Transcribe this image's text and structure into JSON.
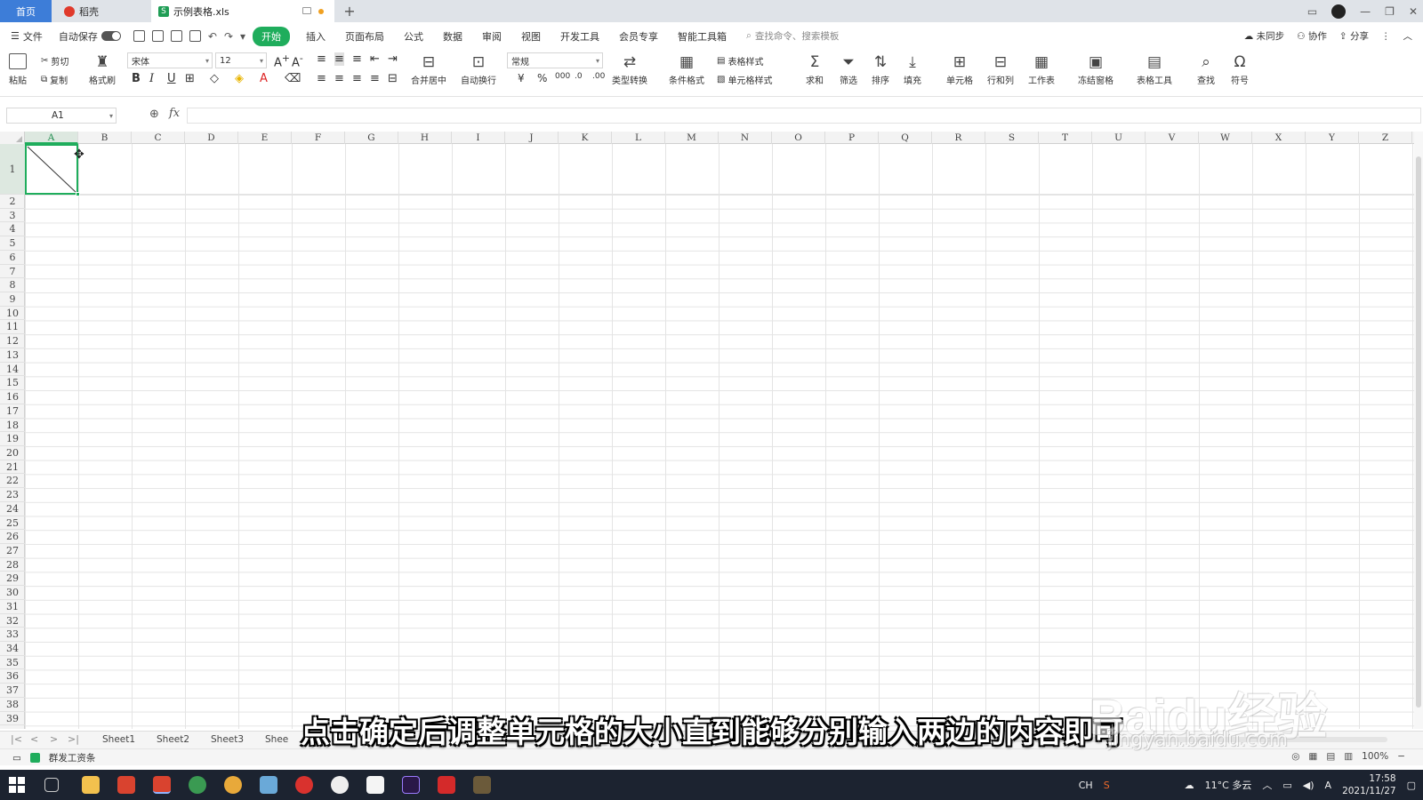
{
  "tabs": {
    "home": "首页",
    "daoke": "稻壳",
    "file": "示例表格.xls",
    "add": "+"
  },
  "menu": {
    "file": "文件",
    "autosave": "自动保存",
    "items": [
      "开始",
      "插入",
      "页面布局",
      "公式",
      "数据",
      "审阅",
      "视图",
      "开发工具",
      "会员专享",
      "智能工具箱"
    ],
    "search_placeholder": "查找命令、搜索模板",
    "sync": "未同步",
    "collab": "协作",
    "share": "分享"
  },
  "ribbon": {
    "paste": "粘贴",
    "cut": "剪切",
    "copy": "复制",
    "format_painter": "格式刷",
    "font_name": "宋体",
    "font_size": "12",
    "merge_center": "合并居中",
    "wrap_text": "自动换行",
    "number_format": "常规",
    "type_convert": "类型转换",
    "conditional_format": "条件格式",
    "table_style": "表格样式",
    "cell_style": "单元格样式",
    "sum": "求和",
    "filter": "筛选",
    "sort": "排序",
    "fill": "填充",
    "cell": "单元格",
    "row_col": "行和列",
    "worksheet": "工作表",
    "freeze": "冻结窗格",
    "table_tools": "表格工具",
    "find": "查找",
    "symbol": "符号"
  },
  "formula_bar": {
    "cell_ref": "A1",
    "fx": "fx"
  },
  "columns": [
    "A",
    "B",
    "C",
    "D",
    "E",
    "F",
    "G",
    "H",
    "I",
    "J",
    "K",
    "L",
    "M",
    "N",
    "O",
    "P",
    "Q",
    "R",
    "S",
    "T",
    "U",
    "V",
    "W",
    "X",
    "Y",
    "Z"
  ],
  "rows": [
    "1",
    "2",
    "3",
    "4",
    "5",
    "6",
    "7",
    "8",
    "9",
    "10",
    "11",
    "12",
    "13",
    "14",
    "15",
    "16",
    "17",
    "18",
    "19",
    "20",
    "21",
    "22",
    "23",
    "24",
    "25",
    "26",
    "27",
    "28",
    "29",
    "30",
    "31",
    "32",
    "33",
    "34",
    "35",
    "36",
    "37",
    "38",
    "39"
  ],
  "sheets": [
    "Sheet1",
    "Sheet2",
    "Sheet3",
    "Shee"
  ],
  "status": {
    "left": "群发工资条",
    "zoom": "100%"
  },
  "taskbar": {
    "lang": "CH",
    "weather": "11°C 多云",
    "time": "17:58",
    "date": "2021/11/27"
  },
  "subtitle": "点击确定后调整单元格的大小直到能够分别输入两边的内容即可",
  "watermark": {
    "brand": "Baidu经验",
    "site": "jingyan.baidu.com"
  },
  "colors": {
    "accent": "#1fad5c",
    "home_tab": "#3d7dd8"
  }
}
